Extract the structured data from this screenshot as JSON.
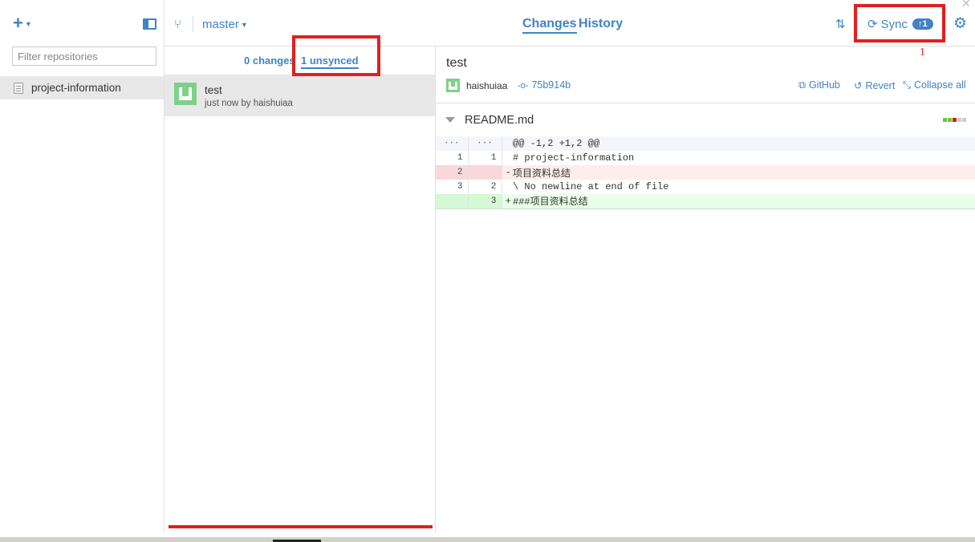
{
  "sidebar": {
    "filter_placeholder": "Filter repositories",
    "repositories": [
      {
        "name": "project-information"
      }
    ]
  },
  "toolbar": {
    "branch": "master",
    "tabs": [
      {
        "label": "Changes",
        "active": true
      },
      {
        "label": "History",
        "active": false
      }
    ],
    "sync_label": "Sync",
    "sync_badge": "↑1"
  },
  "annotation": {
    "number": "1",
    "color": "#e02020"
  },
  "middle": {
    "tabs": [
      {
        "label": "0 changes",
        "active": false
      },
      {
        "label": "1 unsynced",
        "active": true
      }
    ],
    "commits": [
      {
        "title": "test",
        "subtitle": "just now by haishuiaa"
      }
    ]
  },
  "detail": {
    "title": "test",
    "author": "haishuiaa",
    "sha": "75b914b",
    "actions": {
      "github": "GitHub",
      "revert": "Revert",
      "collapse": "Collapse all"
    },
    "file": {
      "name": "README.md",
      "diff": [
        {
          "type": "hunk",
          "old": "···",
          "new": "···",
          "sign": "",
          "code": "@@ -1,2 +1,2 @@"
        },
        {
          "type": "context",
          "old": "1",
          "new": "1",
          "sign": "",
          "code": "# project-information"
        },
        {
          "type": "del",
          "old": "2",
          "new": "",
          "sign": "-",
          "code": "项目资料总结"
        },
        {
          "type": "context",
          "old": "3",
          "new": "2",
          "sign": "",
          "code": "\\ No newline at end of file"
        },
        {
          "type": "add",
          "old": "",
          "new": "3",
          "sign": "+",
          "code": "###项目资料总结"
        }
      ]
    }
  },
  "colors": {
    "accent": "#4183c4",
    "selected_bg": "#e8e8e8",
    "del_bg": "#ffecec",
    "add_bg": "#eaffea"
  }
}
